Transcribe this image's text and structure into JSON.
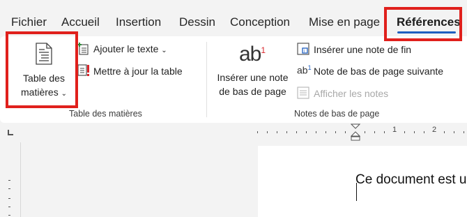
{
  "tabs": [
    {
      "label": "Fichier"
    },
    {
      "label": "Accueil"
    },
    {
      "label": "Insertion"
    },
    {
      "label": "Dessin"
    },
    {
      "label": "Conception"
    },
    {
      "label": "Mise en page"
    },
    {
      "label": "Références"
    }
  ],
  "toc_group": {
    "table_button_line1": "Table des",
    "table_button_line2": "matières",
    "add_text": "Ajouter le texte",
    "update_table": "Mettre à jour la table",
    "group_label": "Table des matières"
  },
  "footnotes_group": {
    "insert_footnote_line1": "Insérer une note",
    "insert_footnote_line2": "de bas de page",
    "insert_endnote": "Insérer une note de fin",
    "next_footnote": "Note de bas de page suivante",
    "show_notes": "Afficher les notes",
    "group_label": "Notes de bas de page"
  },
  "ruler": {
    "numbers": [
      "1",
      "2"
    ]
  },
  "document": {
    "text": "Ce document est u"
  },
  "colors": {
    "highlight": "#e0201c",
    "active_tab_underline": "#1f5fbf",
    "ribbon_bg": "#ffffff",
    "app_bg": "#f3f3f3"
  }
}
